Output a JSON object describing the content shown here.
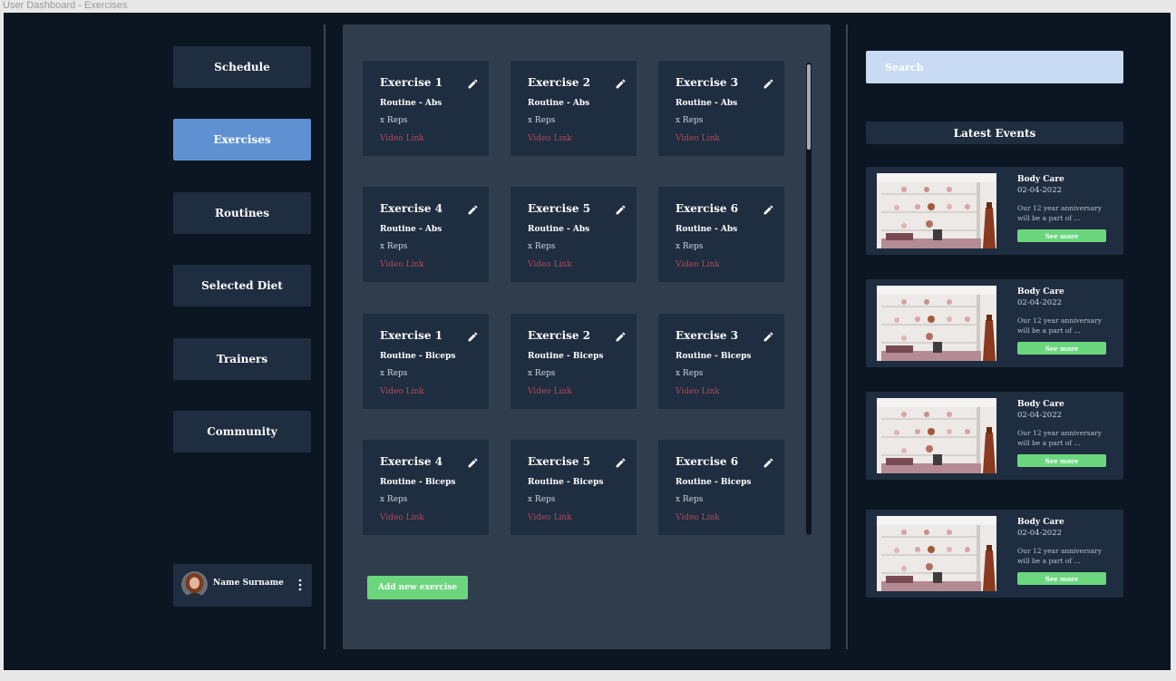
{
  "window": {
    "title": "User Dashboard - Exercises"
  },
  "sidebar": {
    "items": [
      {
        "label": "Schedule"
      },
      {
        "label": "Exercises",
        "active": true
      },
      {
        "label": "Routines"
      },
      {
        "label": "Selected Diet"
      },
      {
        "label": "Trainers"
      },
      {
        "label": "Community"
      }
    ],
    "user": {
      "name": "Name Surname",
      "avatar_icon": "user-avatar",
      "menu_icon": "kebab-icon"
    }
  },
  "main": {
    "exercises": [
      {
        "title": "Exercise 1",
        "routine": "Routine - Abs",
        "reps": "x Reps",
        "link": "Video Link"
      },
      {
        "title": "Exercise 2",
        "routine": "Routine - Abs",
        "reps": "x Reps",
        "link": "Video Link"
      },
      {
        "title": "Exercise 3",
        "routine": "Routine - Abs",
        "reps": "x Reps",
        "link": "Video Link"
      },
      {
        "title": "Exercise 4",
        "routine": "Routine - Abs",
        "reps": "x Reps",
        "link": "Video Link"
      },
      {
        "title": "Exercise 5",
        "routine": "Routine - Abs",
        "reps": "x Reps",
        "link": "Video Link"
      },
      {
        "title": "Exercise 6",
        "routine": "Routine - Abs",
        "reps": "x Reps",
        "link": "Video Link"
      },
      {
        "title": "Exercise 1",
        "routine": "Routine - Biceps",
        "reps": "x Reps",
        "link": "Video Link"
      },
      {
        "title": "Exercise 2",
        "routine": "Routine - Biceps",
        "reps": "x Reps",
        "link": "Video Link"
      },
      {
        "title": "Exercise 3",
        "routine": "Routine - Biceps",
        "reps": "x Reps",
        "link": "Video Link"
      },
      {
        "title": "Exercise 4",
        "routine": "Routine - Biceps",
        "reps": "x Reps",
        "link": "Video Link"
      },
      {
        "title": "Exercise 5",
        "routine": "Routine - Biceps",
        "reps": "x Reps",
        "link": "Video Link"
      },
      {
        "title": "Exercise 6",
        "routine": "Routine - Biceps",
        "reps": "x Reps",
        "link": "Video Link"
      }
    ],
    "add_label": "Add new exercise",
    "edit_icon": "pencil-icon"
  },
  "right": {
    "search_placeholder": "Search",
    "events_heading": "Latest Events",
    "events": [
      {
        "title": "Body Care",
        "date": "02-04-2022",
        "desc": "Our 12 year anniversary will be a part of ...",
        "button": "See more"
      },
      {
        "title": "Body Care",
        "date": "02-04-2022",
        "desc": "Our 12 year anniversary will be a part of ...",
        "button": "See more"
      },
      {
        "title": "Body Care",
        "date": "02-04-2022",
        "desc": "Our 12 year anniversary will be a part of ...",
        "button": "See more"
      },
      {
        "title": "Body Care",
        "date": "02-04-2022",
        "desc": "Our 12 year anniversary will be a part of ...",
        "button": "See more"
      }
    ]
  },
  "colors": {
    "background": "#0b1622",
    "panel": "#303d4c",
    "card": "#1f2d40",
    "active": "#5f91d2",
    "accent_green": "#6bd67e",
    "link_red": "#b04a56",
    "search_bg": "#c8dbf2"
  }
}
